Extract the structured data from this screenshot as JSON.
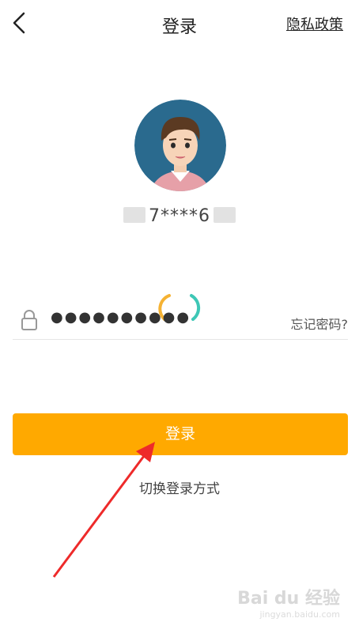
{
  "header": {
    "title": "登录",
    "privacy_label": "隐私政策"
  },
  "account": {
    "masked_number": "7****6"
  },
  "password": {
    "value": "●●●●●●●●●●",
    "forgot_label": "忘记密码?"
  },
  "actions": {
    "login_label": "登录",
    "switch_label": "切换登录方式"
  },
  "watermark": {
    "brand": "Bai du 经验",
    "url": "jingyan.baidu.com"
  },
  "colors": {
    "accent": "#ffa900",
    "annotation_arrow": "#ee2a2a",
    "spinner_orange": "#f5b233",
    "spinner_teal": "#3ec7b6"
  }
}
